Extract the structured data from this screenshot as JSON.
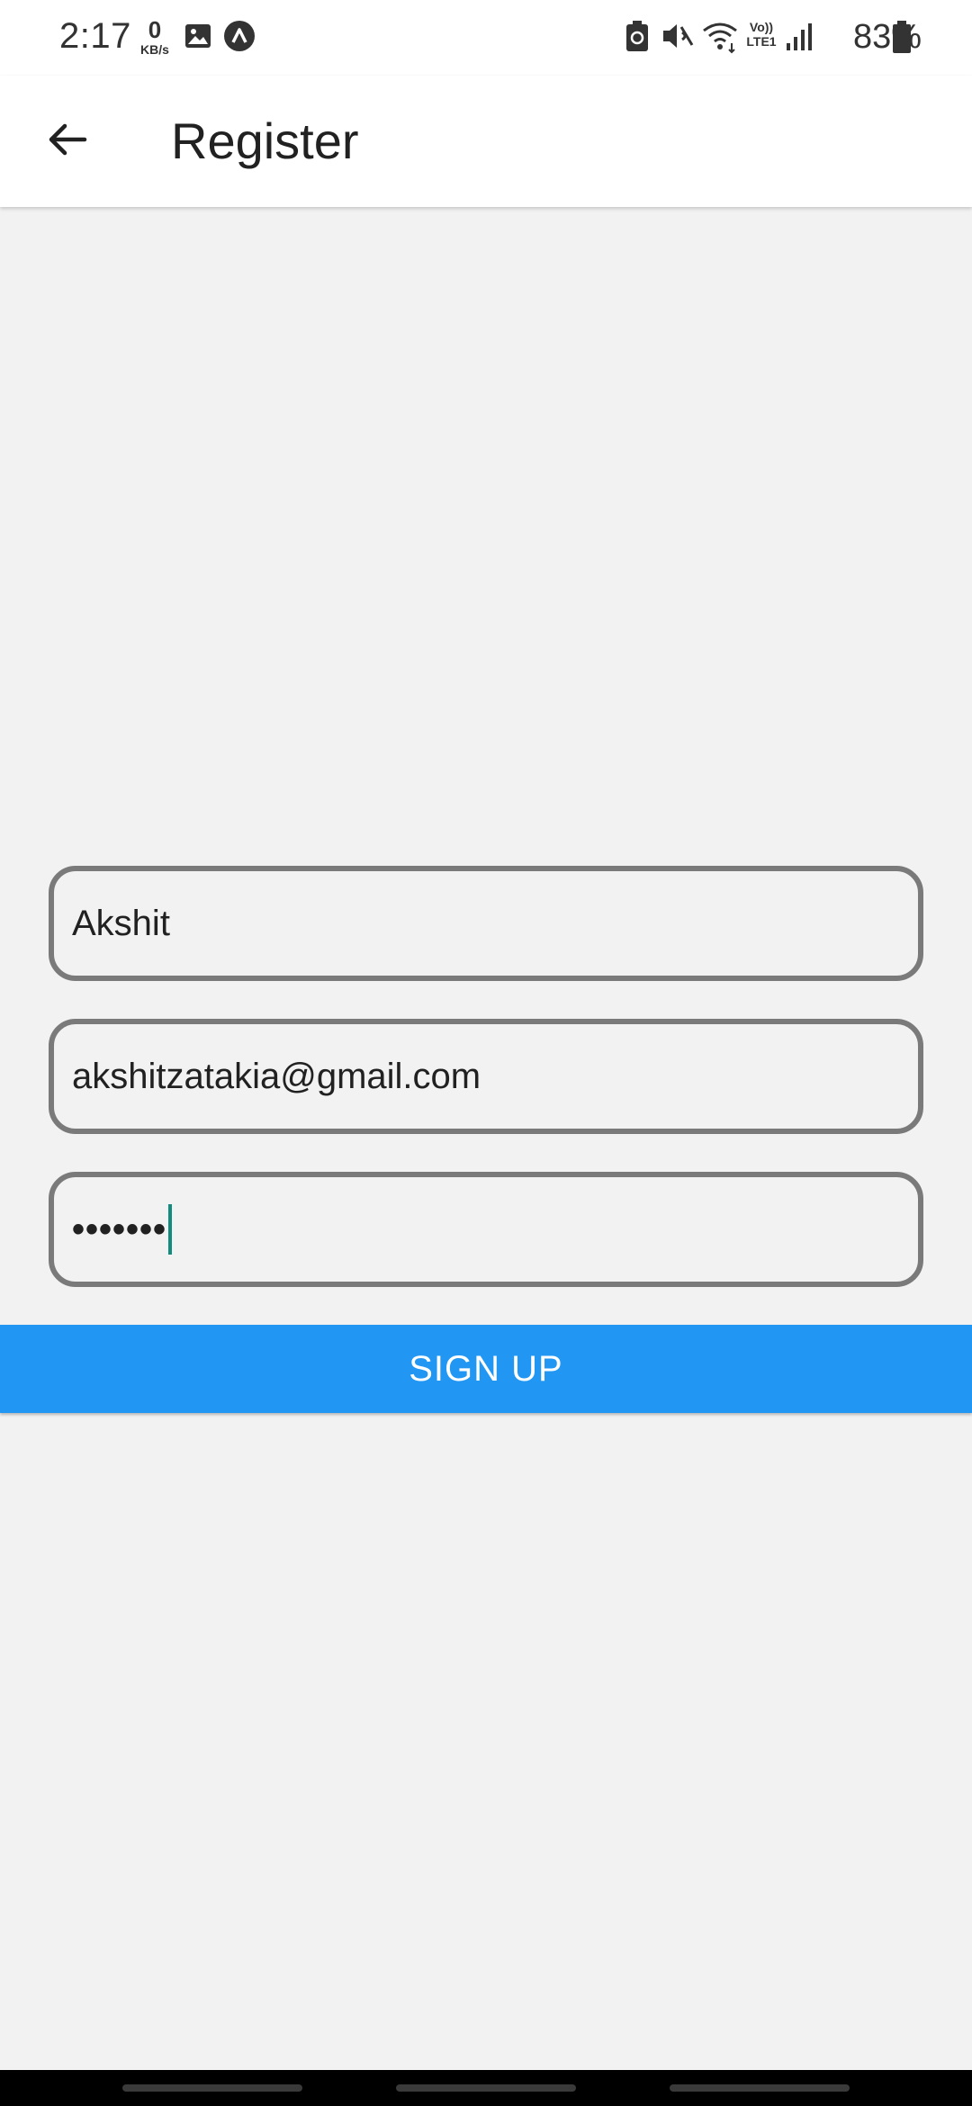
{
  "status_bar": {
    "time": "2:17",
    "net_speed_value": "0",
    "net_speed_unit": "KB/s",
    "battery_percent": "83%",
    "icons": [
      "image-icon",
      "app-notification-icon",
      "battery-saver-icon",
      "mute-icon",
      "wifi-icon",
      "volte-icon",
      "signal-icon",
      "battery-icon"
    ],
    "volte_label": "Vo)) LTE1"
  },
  "app_bar": {
    "back_icon": "arrow-left-icon",
    "title": "Register"
  },
  "form": {
    "name_value": "Akshit",
    "email_value": "akshitzatakia@gmail.com",
    "password_masked": "•••••••"
  },
  "signup_label": "SIGN UP",
  "colors": {
    "accent": "#2196f3",
    "field_border": "#7a7a7a",
    "cursor": "#128c7e",
    "background": "#f2f2f2"
  }
}
